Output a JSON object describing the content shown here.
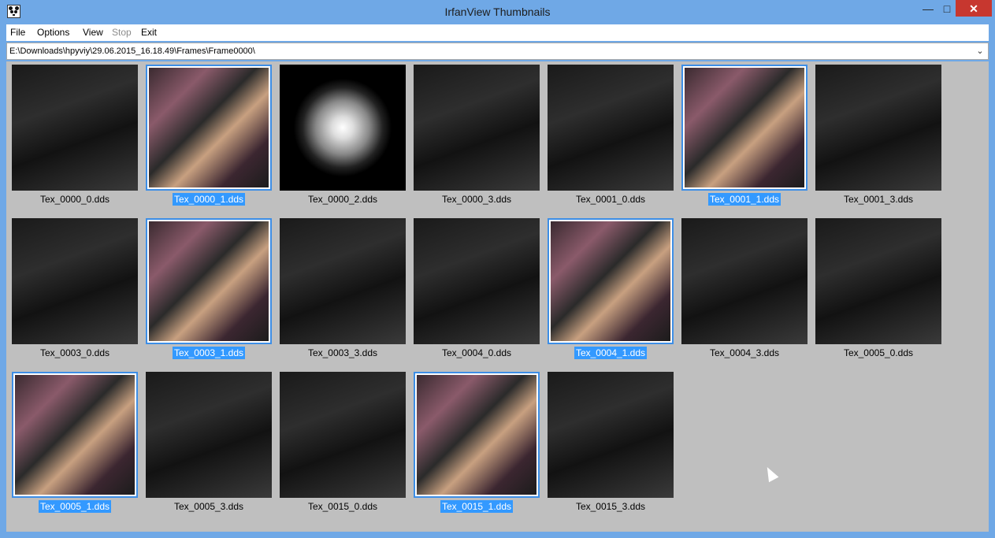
{
  "window": {
    "title": "IrfanView Thumbnails"
  },
  "title_buttons": {
    "minimize": "—",
    "maximize": "□",
    "close": "✕"
  },
  "menu": [
    "File",
    "Options",
    "View",
    "Stop",
    "Exit"
  ],
  "path": "E:\\Downloads\\hpyviy\\29.06.2015_16.18.49\\Frames\\Frame0000\\",
  "thumbnails": [
    {
      "name": "Tex_0000_0.dds",
      "selected": false
    },
    {
      "name": "Tex_0000_1.dds",
      "selected": true
    },
    {
      "name": "Tex_0000_2.dds",
      "selected": false
    },
    {
      "name": "Tex_0000_3.dds",
      "selected": false
    },
    {
      "name": "Tex_0001_0.dds",
      "selected": false
    },
    {
      "name": "Tex_0001_1.dds",
      "selected": true
    },
    {
      "name": "Tex_0001_3.dds",
      "selected": false
    },
    {
      "name": "Tex_0003_0.dds",
      "selected": false
    },
    {
      "name": "Tex_0003_1.dds",
      "selected": true
    },
    {
      "name": "Tex_0003_3.dds",
      "selected": false
    },
    {
      "name": "Tex_0004_0.dds",
      "selected": false
    },
    {
      "name": "Tex_0004_1.dds",
      "selected": true
    },
    {
      "name": "Tex_0004_3.dds",
      "selected": false
    },
    {
      "name": "Tex_0005_0.dds",
      "selected": false
    },
    {
      "name": "Tex_0005_1.dds",
      "selected": true
    },
    {
      "name": "Tex_0005_3.dds",
      "selected": false
    },
    {
      "name": "Tex_0015_0.dds",
      "selected": false
    },
    {
      "name": "Tex_0015_1.dds",
      "selected": true
    },
    {
      "name": "Tex_0015_3.dds",
      "selected": false
    }
  ]
}
